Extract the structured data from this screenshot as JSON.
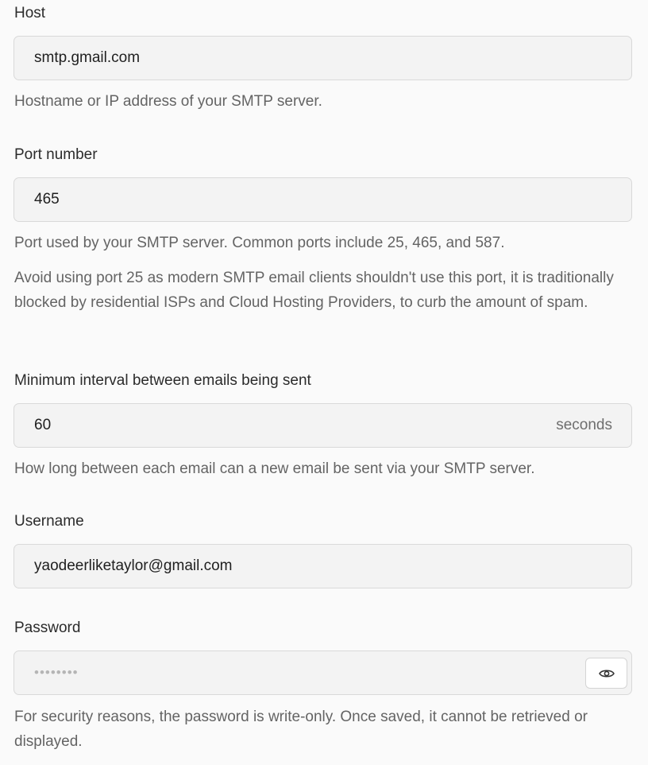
{
  "host": {
    "label": "Host",
    "value": "smtp.gmail.com",
    "hint": "Hostname or IP address of your SMTP server."
  },
  "port": {
    "label": "Port number",
    "value": "465",
    "hint": "Port used by your SMTP server. Common ports include 25, 465, and 587.",
    "note": "Avoid using port 25 as modern SMTP email clients shouldn't use this port, it is traditionally blocked by residential ISPs and Cloud Hosting Providers, to curb the amount of spam."
  },
  "interval": {
    "label": "Minimum interval between emails being sent",
    "value": "60",
    "suffix": "seconds",
    "hint": "How long between each email can a new email be sent via your SMTP server."
  },
  "username": {
    "label": "Username",
    "value": "yaodeerliketaylor@gmail.com"
  },
  "password": {
    "label": "Password",
    "masked_value": "••••••••",
    "toggle_icon": "eye-icon",
    "hint": "For security reasons, the password is write-only. Once saved, it cannot be retrieved or displayed."
  }
}
